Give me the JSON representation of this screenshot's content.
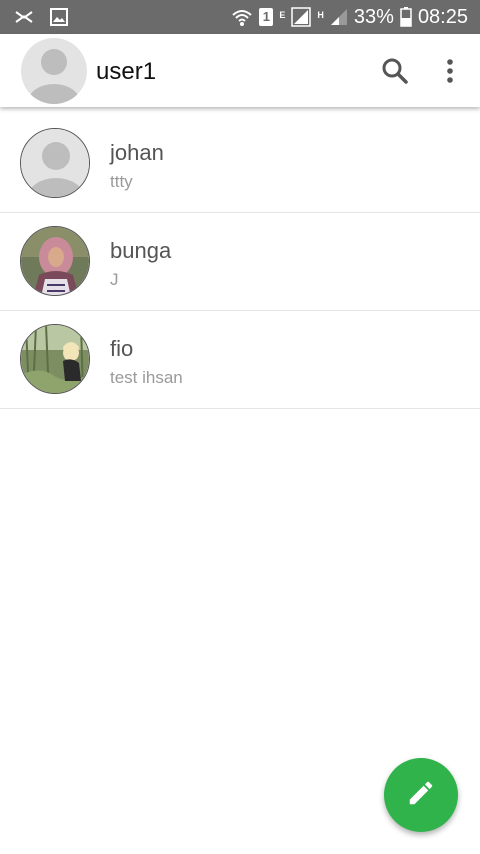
{
  "status_bar": {
    "battery": "33%",
    "time": "08:25",
    "sim": "1",
    "network_type_1": "E",
    "network_type_2": "H"
  },
  "app_bar": {
    "title": "user1",
    "icons": [
      "avatar-placeholder",
      "search-icon",
      "more-vert-icon"
    ]
  },
  "chats": [
    {
      "name": "johan",
      "last_message": "ttty",
      "avatar": "default-avatar"
    },
    {
      "name": "bunga",
      "last_message": "J",
      "avatar": "photo-woman-hijab"
    },
    {
      "name": "fio",
      "last_message": "test ihsan",
      "avatar": "photo-outdoor-woman"
    }
  ],
  "fab": {
    "icon": "pencil-icon",
    "color": "#2fb34a"
  }
}
